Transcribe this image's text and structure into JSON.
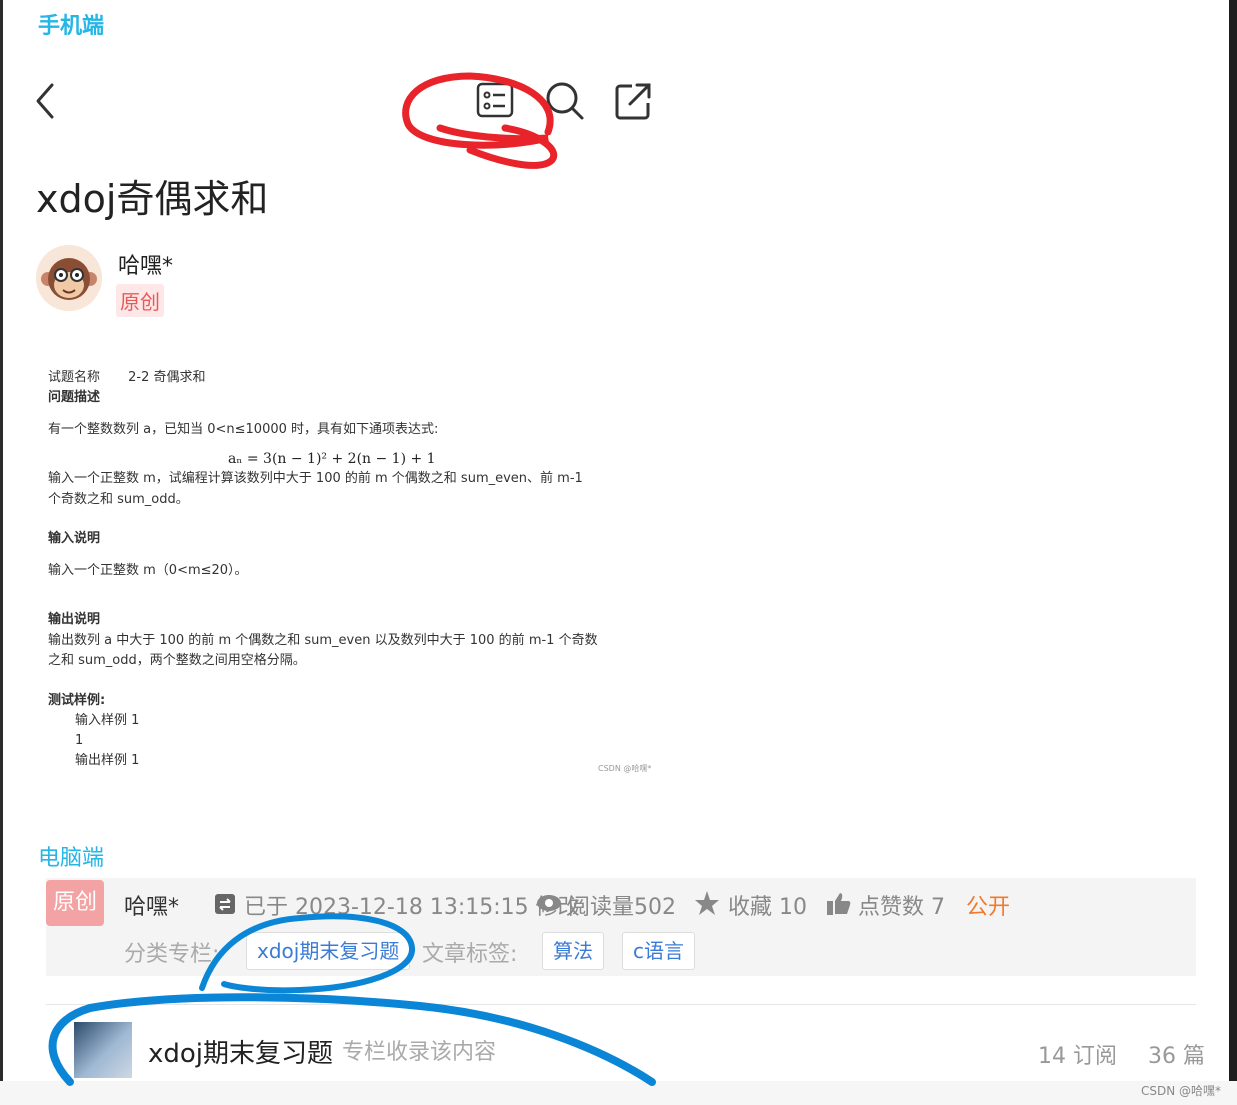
{
  "mobile_label": "手机端",
  "pc_label": "电脑端",
  "mobile_toolbar": {
    "back_icon": "chevron-left-icon",
    "list_icon": "list-icon",
    "search_icon": "search-icon",
    "share_icon": "share-icon"
  },
  "article": {
    "title": "xdoj奇偶求和",
    "author": "哈嘿*",
    "badge": "原创"
  },
  "problem": {
    "name_label": "试题名称",
    "name_value": "2-2 奇偶求和",
    "desc_heading": "问题描述",
    "desc_line1": "有一个整数数列 a，已知当 0<n≤10000 时，具有如下通项表达式:",
    "formula": "aₙ = 3(n − 1)² + 2(n − 1) + 1",
    "desc_line2": "输入一个正整数 m，试编程计算该数列中大于 100 的前 m 个偶数之和 sum_even、前 m-1",
    "desc_line3": "个奇数之和 sum_odd。",
    "input_heading": "输入说明",
    "input_text": "输入一个正整数 m（0<m≤20）。",
    "output_heading": "输出说明",
    "output_line1": "输出数列 a 中大于 100 的前 m 个偶数之和 sum_even 以及数列中大于 100 的前 m-1 个奇数",
    "output_line2": "之和 sum_odd，两个整数之间用空格分隔。",
    "sample_heading": "测试样例:",
    "sample_in_label": "输入样例 1",
    "sample_in_value": "1",
    "sample_out_label": "输出样例 1",
    "watermark": "CSDN @哈嘿*"
  },
  "pc_meta": {
    "badge": "原创",
    "author": "哈嘿*",
    "modified": "已于 2023-12-18 13:15:15 修改",
    "reads": "阅读量502",
    "favorites": "收藏 10",
    "likes": "点赞数 7",
    "visibility": "公开",
    "category_label": "分类专栏:",
    "category_tag": "xdoj期末复习题",
    "tags_label": "文章标签:",
    "tag1": "算法",
    "tag2": "c语言"
  },
  "column_card": {
    "title": "xdoj期末复习题",
    "subtitle": "专栏收录该内容",
    "subscribers": "14 订阅",
    "count": "36 篇"
  },
  "footer_watermark": "CSDN @哈嘿*",
  "colors": {
    "accent": "#25b5e6",
    "red_annotation": "#e8232a",
    "blue_annotation": "#0b86d6",
    "visibility": "#f07b2e"
  }
}
